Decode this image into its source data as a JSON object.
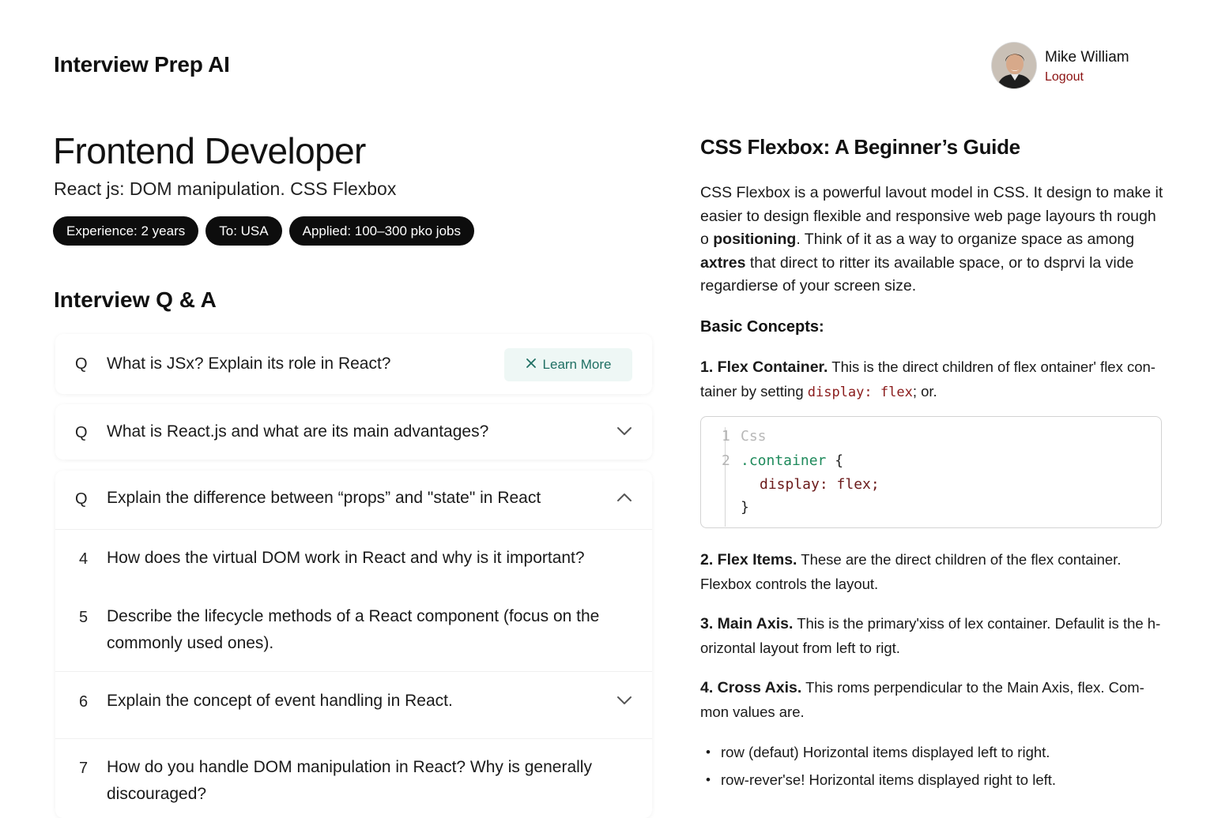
{
  "header": {
    "app_title": "Interview Prep AI",
    "user_name": "Mike William",
    "logout_label": "Logout"
  },
  "session": {
    "role": "Frontend Developer",
    "topics": "React js: DOM manipulation. CSS Flexbox",
    "tags": [
      "Experience: 2 years",
      "To: USA",
      "Applied: 100–300 pko jobs"
    ]
  },
  "qa": {
    "heading": "Interview Q & A",
    "learn_more_label": "Learn More",
    "items": [
      {
        "marker": "Q",
        "text": "What is JSx? Explain its role in React?"
      },
      {
        "marker": "Q",
        "text": "What is React.js and what are its main advantages?"
      },
      {
        "marker": "Q",
        "text": "Explain the difference between “props” and \"state\" in React"
      },
      {
        "marker": "4",
        "text": "How does the virtual DOM work in React and why is it important?"
      },
      {
        "marker": "5",
        "text": "Describe the lifecycle methods of a React component (focus on the commonly used ones)."
      },
      {
        "marker": "6",
        "text": "Explain the concept of event handling in React."
      },
      {
        "marker": "7",
        "text": "How do you handle DOM manipulation in React? Why is generally discouraged?"
      }
    ]
  },
  "guide": {
    "title": "CSS Flexbox: A Beginner’s Guide",
    "intro_a": "CSS Flexbox is a powerful lavout model in CSS. It design to make it easier to design flexible and responsive web page layours th rough o ",
    "intro_bold1": "positioning",
    "intro_b": ". Think of it as a way to organize space as among ",
    "intro_bold2": "axtres",
    "intro_c": " that direct to ritter its available space, or to dsprvi la vide regardierse of your screen size.",
    "basic_concepts_label": "Basic Concepts:",
    "concept1_title": "1. Flex Container.",
    "concept1_text": " This is the direct children of flex ontainer' flex con-tainer by setting ",
    "concept1_code": "display: flex",
    "concept1_end": "; or.",
    "code": {
      "line1_num": "1",
      "line1": "Css",
      "line2_num": "2",
      "line2_sel": ".container",
      "line2_brace": " {",
      "line3_prop": "display:",
      "line3_val": " flex;",
      "line4": "}"
    },
    "concept2_title": "2. Flex Items.",
    "concept2_text": " These are the direct children of the flex container. Flexbox controls the layout.",
    "concept3_title": "3. Main Axis.",
    "concept3_text": " This is the primary'xiss of lex container. Defaulit is the h-orizontal layout from left to rigt.",
    "concept4_title": "4. Cross Axis.",
    "concept4_text": " This roms perpendicular to the Main Axis, flex. Com-mon values are.",
    "bullets": [
      "row (defaut) Horizontal items displayed left to right.",
      "row-rever'se! Horizontal items displayed right to left."
    ]
  }
}
